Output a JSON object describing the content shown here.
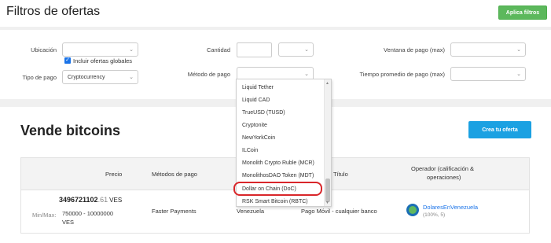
{
  "header": {
    "title": "Filtros de ofertas",
    "apply_button": "Aplica filtros"
  },
  "filters": {
    "location_label": "Ubicación",
    "location_value": "",
    "include_global_label": "Incluir ofertas globales",
    "include_global_checked": true,
    "payment_type_label": "Tipo de pago",
    "payment_type_value": "Cryptocurrency",
    "amount_label": "Cantidad",
    "amount_value": "",
    "currency_value": "",
    "payment_method_label": "Método de pago",
    "payment_method_value": "",
    "payment_window_label": "Ventana de pago (max)",
    "payment_window_value": "",
    "avg_payment_time_label": "Tiempo promedio de pago (max)",
    "avg_payment_time_value": ""
  },
  "dropdown": {
    "options": [
      "Liquid Tether",
      "Liquid CAD",
      "TrueUSD (TUSD)",
      "Cryptonite",
      "NewYorkCoin",
      "ILCoin",
      "Monolith Crypto Ruble (MCR)",
      "MonolithosDAO Token (MDT)",
      "Dollar on Chain (DoC)",
      "RSK Smart Bitcoin (RBTC)"
    ],
    "highlighted": "Dollar on Chain (DoC)"
  },
  "main": {
    "title": "Vende bitcoins",
    "create_button": "Crea tu oferta"
  },
  "table": {
    "headers": {
      "price": "Precio",
      "methods": "Métodos de pago",
      "title": "Título",
      "operator_line1": "Operador (calificación &",
      "operator_line2": "operaciones)"
    },
    "row": {
      "price_int": "3496721102",
      "price_dec": ".61",
      "currency": "VES",
      "minmax_label": "Min/Max:",
      "minmax_value": "750000 - 10000000",
      "minmax_currency": "VES",
      "method": "Faster Payments",
      "country": "Venezuela",
      "title": "Pago Móvil - cualquier banco",
      "operator_name": "DolaresEnVenezuela",
      "operator_stats": "(100%, 5)"
    }
  }
}
